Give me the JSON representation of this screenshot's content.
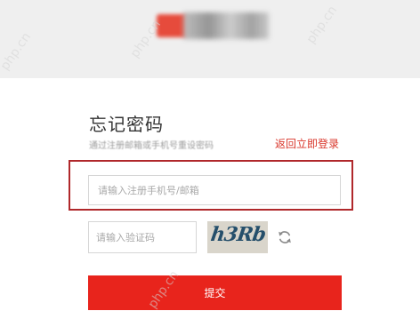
{
  "page": {
    "title": "忘记密码",
    "subtitle": "通过注册邮箱或手机号重设密码",
    "back_link": "返回立即登录",
    "accent_color": "#e8241c",
    "highlight_color": "#b0282b"
  },
  "form": {
    "account_placeholder": "请输入注册手机号/邮箱",
    "captcha_placeholder": "请输入验证码",
    "captcha_code": "h3Rb",
    "refresh_icon": "refresh-icon",
    "submit_label": "提交"
  },
  "watermarks": [
    "php.cn",
    "php.cn",
    "php.cn",
    "php.cn"
  ]
}
